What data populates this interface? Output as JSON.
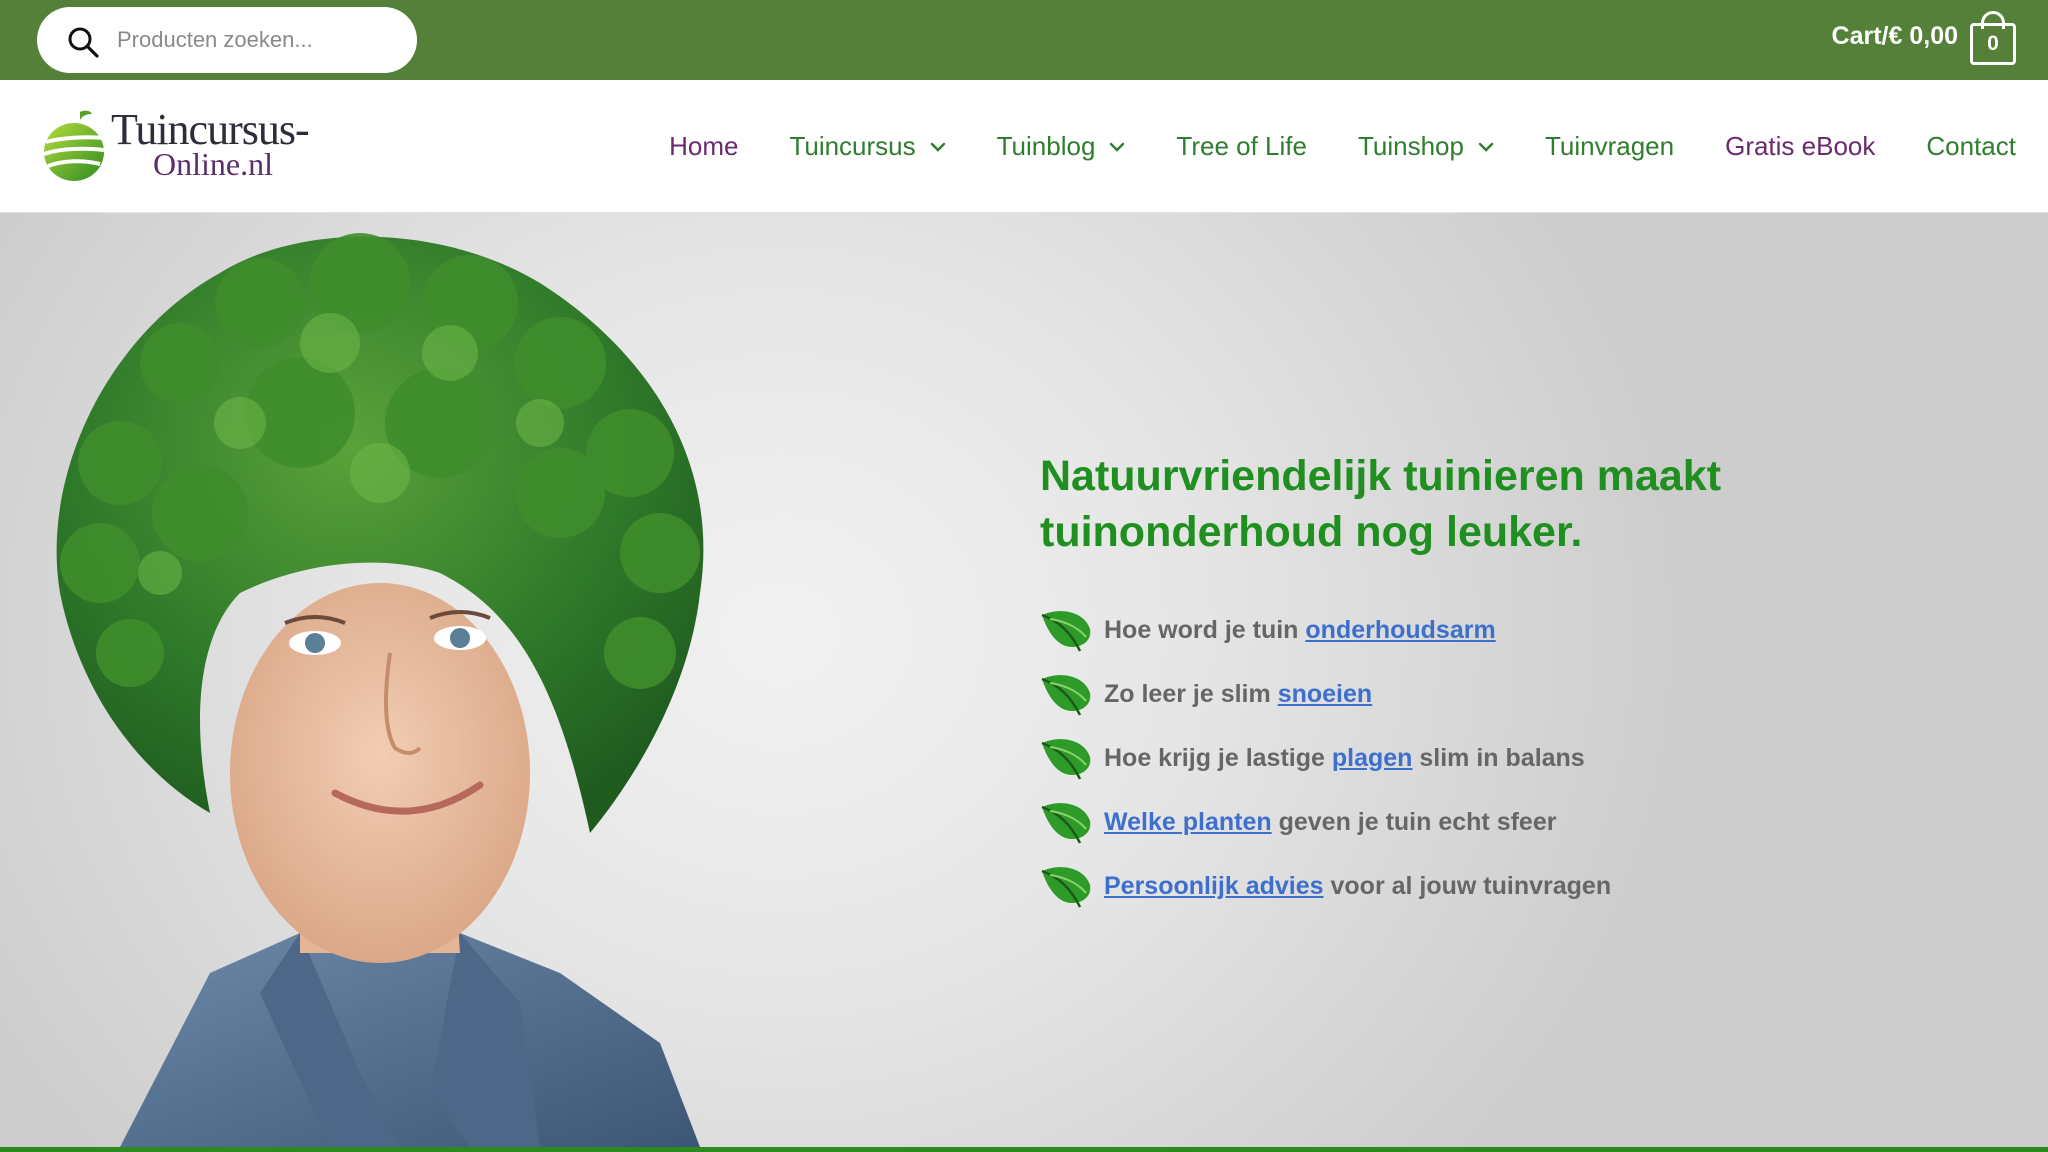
{
  "topbar": {
    "search": {
      "placeholder": "Producten zoeken..."
    },
    "cart": {
      "label": "Cart/€ 0,00",
      "count": "0"
    }
  },
  "logo": {
    "line1": "Tuincursus-",
    "line2": "Online.nl"
  },
  "nav": {
    "items": [
      {
        "label": "Home",
        "has_dropdown": false,
        "color": "#6a2a70"
      },
      {
        "label": "Tuincursus",
        "has_dropdown": true,
        "color": "#2f7d2f"
      },
      {
        "label": "Tuinblog",
        "has_dropdown": true,
        "color": "#2f7d2f"
      },
      {
        "label": "Tree of Life",
        "has_dropdown": false,
        "color": "#2f7d2f"
      },
      {
        "label": "Tuinshop",
        "has_dropdown": true,
        "color": "#2f7d2f"
      },
      {
        "label": "Tuinvragen",
        "has_dropdown": false,
        "color": "#2f7d2f"
      },
      {
        "label": "Gratis eBook",
        "has_dropdown": false,
        "color": "#6a2a70"
      },
      {
        "label": "Contact",
        "has_dropdown": false,
        "color": "#2f7d2f"
      }
    ]
  },
  "hero": {
    "title_line1": "Natuurvriendelijk tuinieren maakt",
    "title_line2": "tuinonderhoud nog leuker.",
    "bullets": [
      {
        "before": "Hoe word je tuin ",
        "link": "onderhoudsarm",
        "after": ""
      },
      {
        "before": "Zo leer je slim ",
        "link": "snoeien",
        "after": ""
      },
      {
        "before": "Hoe krijg je lastige ",
        "link": "plagen",
        "after": " slim in balans"
      },
      {
        "before": "",
        "link": "Welke planten",
        "after": " geven je tuin echt sfeer"
      },
      {
        "before": "",
        "link": "Persoonlijk advies",
        "after": " voor al jouw tuinvragen"
      }
    ]
  },
  "colors": {
    "topbar": "#54803a",
    "nav_green": "#2f7d2f",
    "nav_purple": "#6a2a70",
    "title_green": "#1f8f1f",
    "link_blue": "#3d6fcf",
    "bullet_text": "#666666"
  }
}
